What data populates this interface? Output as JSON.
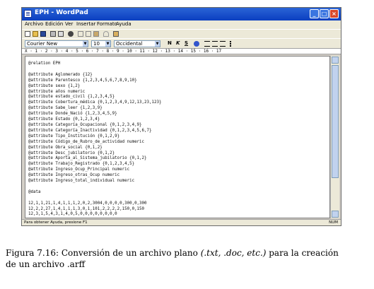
{
  "window": {
    "title": "EPH - WordPad"
  },
  "menu": [
    "Archivo",
    "Edición",
    "Ver",
    "Insertar",
    "Formato",
    "Ayuda"
  ],
  "toolbar_icons": [
    "new-icon",
    "open-icon",
    "save-icon",
    "print-icon",
    "print-preview-icon",
    "find-icon",
    "cut-icon",
    "copy-icon",
    "paste-icon",
    "undo-icon",
    "datetime-icon"
  ],
  "format": {
    "font": "Courier New",
    "size": "10",
    "script": "Occidental",
    "bold": "N",
    "italic": "K",
    "underline": "S"
  },
  "ruler": "X · 1 · 2 · 3 · 4 · 5 · 6 · 7 · 8 · 9 · 10 · 11 · 12 · 13 · 14 · 15 · 16 · 17",
  "document_text": "@relation EPH\n\n@attribute Aglomerado {12}\n@attribute Parentesco {1,2,3,4,5,6,7,8,9,10}\n@attribute sexo {1,2}\n@attribute años numeric\n@attribute estado_civil {1,2,3,4,5}\n@attribute Cobertura_médica {0,1,2,3,4,9,12,13,23,123}\n@attribute Sabe_leer {1,2,3,9}\n@attribute Donde_Nació {1,2,3,4,5,9}\n@attribute Estado {0,1,2,3,4}\n@attribute Categoría_Ocupacional {0,1,2,3,4,9}\n@attribute Categoría_Inactividad {0,1,2,3,4,5,6,7}\n@attribute Tipo_Institución {0,1,2,9}\n@attribute Código_de_Rubro_de_actividad numeric\n@attribute Obra_social {0,1,2}\n@attribute Desc_jubilatorio {0,1,2}\n@attribute Aporta_al_Sistema_jubilatorio {0,1,2}\n@attribute Trabajo_Registrado {0,1,2,3,4,5}\n@attribute Ingreso_Ocup_Principal numeric\n@attribute Ingreso_otras_Ocup numeric\n@attribute Ingreso_total_individual numeric\n\n@data\n\n12,1,1,21,1,4,1,1,1,2,0,2,3004,0,0,0,0,300,0,300\n12,2,2,27,1,4,1,1,1,3,0,1,101,2,2,2,2,150,0,150\n12,3,1,5,4,3,1,4,0,5,0,0,0,0,0,0,0,0",
  "status": {
    "left": "Para obtener Ayuda, presione F1",
    "right": "NUM"
  },
  "caption": {
    "prefix": "Figura 7.16: Conversión de un archivo plano ",
    "italic": "(.txt, .doc, etc.)",
    "suffix": " para la creación",
    "line2": "de un archivo .arff"
  }
}
